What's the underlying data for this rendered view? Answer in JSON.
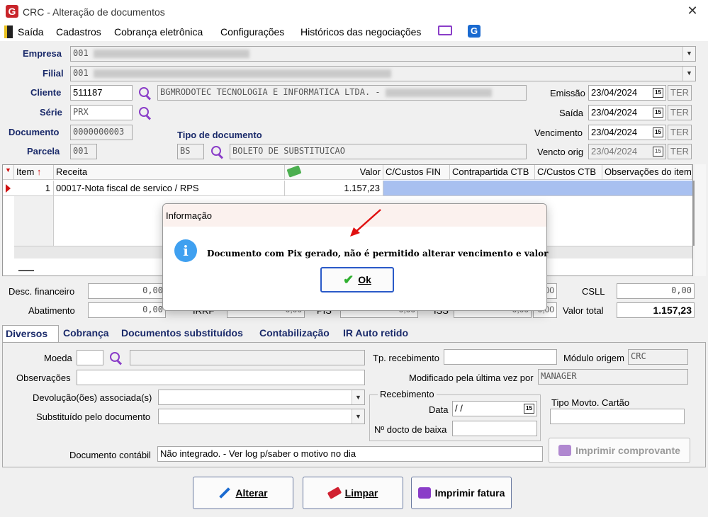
{
  "window": {
    "title": "CRC - Alteração de documentos"
  },
  "menu": {
    "items": [
      "Saída",
      "Cadastros",
      "Cobrança eletrônica",
      "Configurações",
      "Históricos das negociações"
    ]
  },
  "header": {
    "empresa_label": "Empresa",
    "empresa_value": "001",
    "filial_label": "Filial",
    "filial_value": "001",
    "cliente_label": "Cliente",
    "cliente_value": "511187",
    "cliente_name": "BGMRODOTEC TECNOLOGIA E INFORMATICA LTDA. -",
    "serie_label": "Série",
    "serie_value": "PRX",
    "documento_label": "Documento",
    "documento_value": "0000000003",
    "parcela_label": "Parcela",
    "parcela_value": "001",
    "tipo_doc_label": "Tipo de documento",
    "tipo_doc_code": "BS",
    "tipo_doc_name": "BOLETO DE SUBSTITUICAO",
    "emissao_label": "Emissão",
    "emissao_value": "23/04/2024",
    "emissao_day": "TER",
    "saida_label": "Saída",
    "saida_value": "23/04/2024",
    "saida_day": "TER",
    "vencimento_label": "Vencimento",
    "vencimento_value": "23/04/2024",
    "vencimento_day": "TER",
    "vencto_orig_label": "Vencto orig",
    "vencto_orig_value": "23/04/2024",
    "vencto_orig_day": "TER"
  },
  "grid": {
    "columns": [
      "Item",
      "Receita",
      "Valor",
      "C/Custos FIN",
      "Contrapartida CTB",
      "C/Custos CTB",
      "Observações do item"
    ],
    "rows": [
      {
        "item": "1",
        "receita": "00017-Nota fiscal de servico / RPS",
        "valor": "1.157,23"
      }
    ]
  },
  "totals": {
    "desc_fin_label": "Desc. financeiro",
    "desc_fin_value": "0,00",
    "abatimento_label": "Abatimento",
    "abatimento_value": "0,00",
    "irrf_label": "IRRF",
    "irrf_value": "0,00",
    "pis_label": "PIS",
    "pis_value": "0,00",
    "iss_label": "ISS",
    "iss_value": "0,00",
    "col4_value_top": "0,00",
    "col4_value_bottom": "0,00",
    "csll_label": "CSLL",
    "csll_value": "0,00",
    "valor_total_label": "Valor total",
    "valor_total_value": "1.157,23"
  },
  "tabs": [
    "Diversos",
    "Cobrança",
    "Documentos substituídos",
    "Contabilização",
    "IR Auto retido"
  ],
  "diversos": {
    "moeda_label": "Moeda",
    "observacoes_label": "Observações",
    "devolucao_label": "Devolução(ões) associada(s)",
    "substituido_label": "Substituído pelo documento",
    "doc_contabil_label": "Documento contábil",
    "doc_contabil_value": "Não integrado.  - Ver log p/saber o motivo no dia",
    "tp_receb_label": "Tp. recebimento",
    "modulo_label": "Módulo origem",
    "modulo_value": "CRC",
    "modificado_label": "Modificado pela última vez por",
    "modificado_value": "MANAGER",
    "recebimento_group": "Recebimento",
    "data_label": "Data",
    "data_value": " / /",
    "ndocto_label": "Nº docto de baixa",
    "tipo_movto_label": "Tipo Movto. Cartão",
    "imprimir_comprovante": "Imprimir comprovante"
  },
  "buttons": {
    "alterar": "Alterar",
    "limpar": "Limpar",
    "imprimir_fatura": "Imprimir fatura"
  },
  "dialog": {
    "title": "Informação",
    "message": "Documento com Pix gerado, não é permitido alterar vencimento e valor",
    "ok": "Ok"
  },
  "colors": {
    "accent": "#1a2a6a",
    "info": "#3fa0f0",
    "selection": "#a8c0f0",
    "arrow": "#e01010"
  }
}
